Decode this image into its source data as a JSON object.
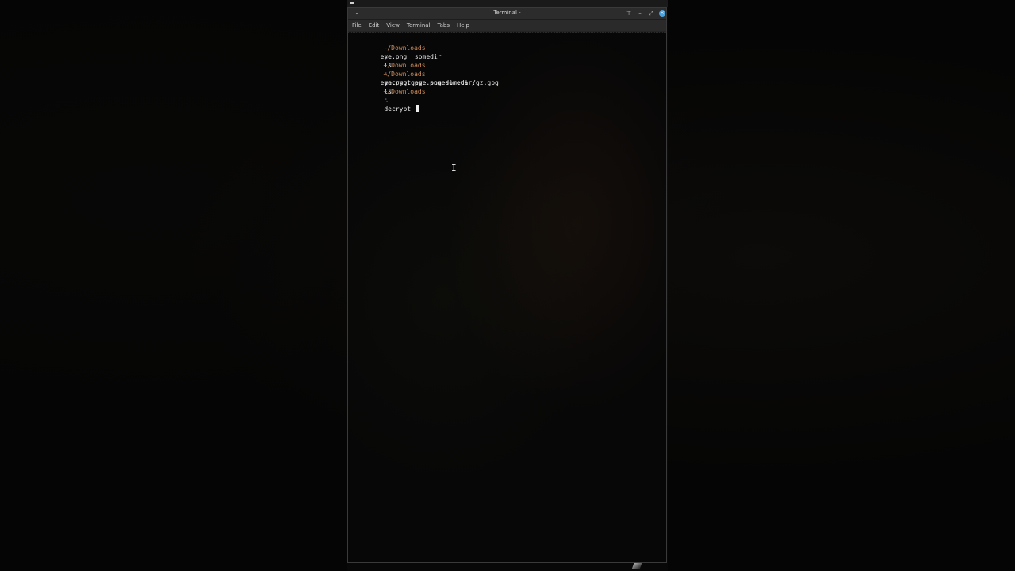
{
  "window": {
    "title": "Terminal -",
    "menu_icon": "chevron-down-icon",
    "controls": {
      "pin_icon": "pin-icon",
      "minimize_icon": "minimize-icon",
      "maximize_icon": "maximize-icon",
      "close_icon": "close-icon"
    }
  },
  "menubar": {
    "items": [
      "File",
      "Edit",
      "View",
      "Terminal",
      "Tabs",
      "Help"
    ]
  },
  "terminal": {
    "lines": [
      {
        "type": "prompt",
        "path": "~/Downloads",
        "symbol": "∴",
        "command": "ls"
      },
      {
        "type": "output",
        "text": "eye.png  somedir"
      },
      {
        "type": "prompt",
        "path": "~/Downloads",
        "symbol": "∴",
        "command": "encrypt eye.png somedir/"
      },
      {
        "type": "prompt",
        "path": "~/Downloads",
        "symbol": "∴",
        "command": "ls"
      },
      {
        "type": "output",
        "text": "eye.png.gpg  somedir.tar.gz.gpg"
      },
      {
        "type": "prompt",
        "path": "~/Downloads",
        "symbol": "∴",
        "command": "decrypt "
      }
    ],
    "cursor_char": "I"
  },
  "colors": {
    "prompt_path": "#d3905d",
    "prompt_symbol": "#9c86c9",
    "close_button": "#4aa3df"
  }
}
